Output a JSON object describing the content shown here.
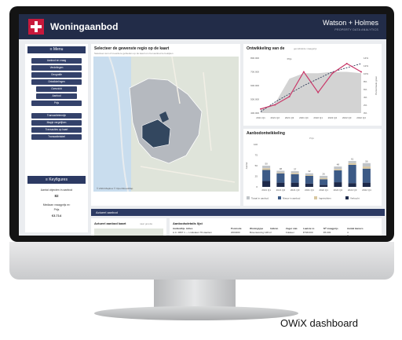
{
  "app": {
    "title": "Woningaanbod",
    "brand": "Watson + Holmes",
    "brand_sub": "PROPERTY DATA ANALYTICS"
  },
  "sidebar": {
    "menu_label": "≡ Menu",
    "items": [
      "Aanbod en vraag",
      "Verdelingen",
      "Geografie",
      "Ontwikkelingen",
      "Overzicht",
      "Aanbod",
      "Prijs",
      "Transactietermijn",
      "Mapje vergelijken",
      "Transacties op kaart",
      "Transactietabel"
    ],
    "keyfigures_label": "≡ Keyfigures",
    "kf_line1": "Aantal objecten in aanbod",
    "kf_value1": "82",
    "kf_line2": "Mediaan vraagprijs m²",
    "kf_line3": "Prijs",
    "kf_value2": "€3.714"
  },
  "map_panel": {
    "title": "Selecteer de gewenste regio op de kaart",
    "subtitle": "Selecteer één of meerdere gebieden op de kaart om het aanbod te bekijken",
    "footer": "© 2024 Mapbox © OpenStreetMap"
  },
  "line_panel": {
    "title": "Ontwikkeling van de",
    "subtitle": "gemiddelde vraagprijs",
    "ylabel": "Percentuele groei"
  },
  "bar_panel": {
    "title": "Aanbodontwikkeling",
    "subtitle": "Prijs"
  },
  "section_bar": "Actueel aanbod",
  "bottom_left": {
    "title": "Actueel aanbod kaart",
    "subtitle": "naar grootte"
  },
  "bottom_right": {
    "title": "Aanbodsdetails lijst",
    "headers": [
      "Aanbodlijs. Adres",
      "Postcode",
      "Woningtype",
      "Indicat.",
      "Zeger stat.",
      "Laatste vr.",
      "M² vraagprijs",
      "Aantal kamers"
    ],
    "row1": [
      "A.C. 0807 1 — Lindelaan 76 Haarlem",
      "2004000",
      "Bovenwoning 148 m²",
      "",
      "Fokkeer",
      "€798.000",
      "€5.003",
      "4"
    ],
    "row2": [
      "",
      "",
      "",
      "",
      "",
      "",
      "",
      "7"
    ]
  },
  "caption": "OWiX dashboard",
  "chart_data": [
    {
      "type": "line",
      "title": "Ontwikkeling van de",
      "x": [
        "2021 Q1",
        "2021 Q2",
        "2021 Q3",
        "2021 Q4",
        "2022 Q1",
        "2022 Q2",
        "2022 Q3",
        "2022 Q4"
      ],
      "ylim_left": [
        400000,
        800000
      ],
      "yticks_left": [
        "400.000",
        "500.000",
        "600.000",
        "700.000",
        "800.000"
      ],
      "yticks_right": [
        "0%",
        "2%",
        "4%",
        "6%",
        "8%",
        "10%",
        "12%",
        "14%"
      ],
      "series": [
        {
          "name": "Prijs",
          "values": [
            430000,
            460000,
            520000,
            700000,
            550000,
            690000,
            760000,
            700000
          ]
        },
        {
          "values": [
            410000,
            480000,
            540000,
            600000,
            650000,
            700000,
            730000,
            760000
          ]
        }
      ],
      "band": [
        430000,
        470000,
        650000,
        690000,
        690000,
        700000,
        700000,
        690000
      ],
      "colors": {
        "line": "#c93a6a",
        "trend": "#1e2a4a",
        "band": "#d3d3d3"
      }
    },
    {
      "type": "bar",
      "title": "Aanbodontwikkeling",
      "categories": [
        "2021 Q1",
        "2021 Q2",
        "2021 Q3",
        "2021 Q4",
        "2022 Q1",
        "2022 Q2",
        "2022 Q3",
        "2022 Q4"
      ],
      "ylim": [
        0,
        100
      ],
      "yticks": [
        "0",
        "25",
        "50",
        "75",
        "100"
      ],
      "ylabel": "Aantal",
      "labels": [
        "50",
        "38",
        "37",
        "32",
        "26",
        "48",
        "61",
        "56"
      ],
      "series": [
        {
          "name": "Totaal in aanbod",
          "values": [
            6,
            4,
            4,
            4,
            5,
            6,
            5,
            8
          ],
          "color": "#c0c4c8"
        },
        {
          "name": "Nieuw in aanbod",
          "values": [
            26,
            22,
            20,
            18,
            13,
            28,
            43,
            33
          ],
          "color": "#3c5a86"
        },
        {
          "name": "Ingetrokken",
          "values": [
            4,
            2,
            3,
            2,
            3,
            3,
            4,
            5
          ],
          "color": "#d8c7a0"
        },
        {
          "name": "Verkocht",
          "values": [
            14,
            10,
            10,
            8,
            5,
            11,
            9,
            10
          ],
          "color": "#1e2a4a"
        }
      ]
    }
  ]
}
